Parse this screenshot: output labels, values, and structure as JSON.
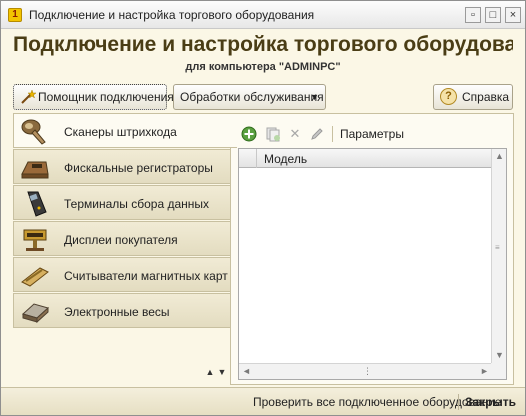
{
  "window": {
    "title": "Подключение и настройка торгового оборудования"
  },
  "header": {
    "title": "Подключение и настройка торгового оборудова...",
    "subtitle": "для компьютера \"ADMINPC\""
  },
  "toolbar": {
    "assistant_label": "Помощник подключения",
    "processing_label": "Обработки обслуживания",
    "help_label": "Справка"
  },
  "categories": [
    {
      "label": "Сканеры штрихкода",
      "icon": "barcode-scanner-icon"
    },
    {
      "label": "Фискальные регистраторы",
      "icon": "fiscal-register-icon"
    },
    {
      "label": "Терминалы сбора данных",
      "icon": "data-terminal-icon"
    },
    {
      "label": "Дисплеи покупателя",
      "icon": "customer-display-icon"
    },
    {
      "label": "Считыватели магнитных карт",
      "icon": "card-reader-icon"
    },
    {
      "label": "Электронные весы",
      "icon": "scales-icon"
    }
  ],
  "panel": {
    "params_label": "Параметры",
    "grid": {
      "columns": [
        "Модель"
      ]
    }
  },
  "footer": {
    "check_all_label": "Проверить все подключенное оборудование",
    "close_label": "Закрыть"
  },
  "colors": {
    "background": "#fbf7e6",
    "category_bg": "#e9e3c9",
    "title_text": "#4a3d15"
  }
}
